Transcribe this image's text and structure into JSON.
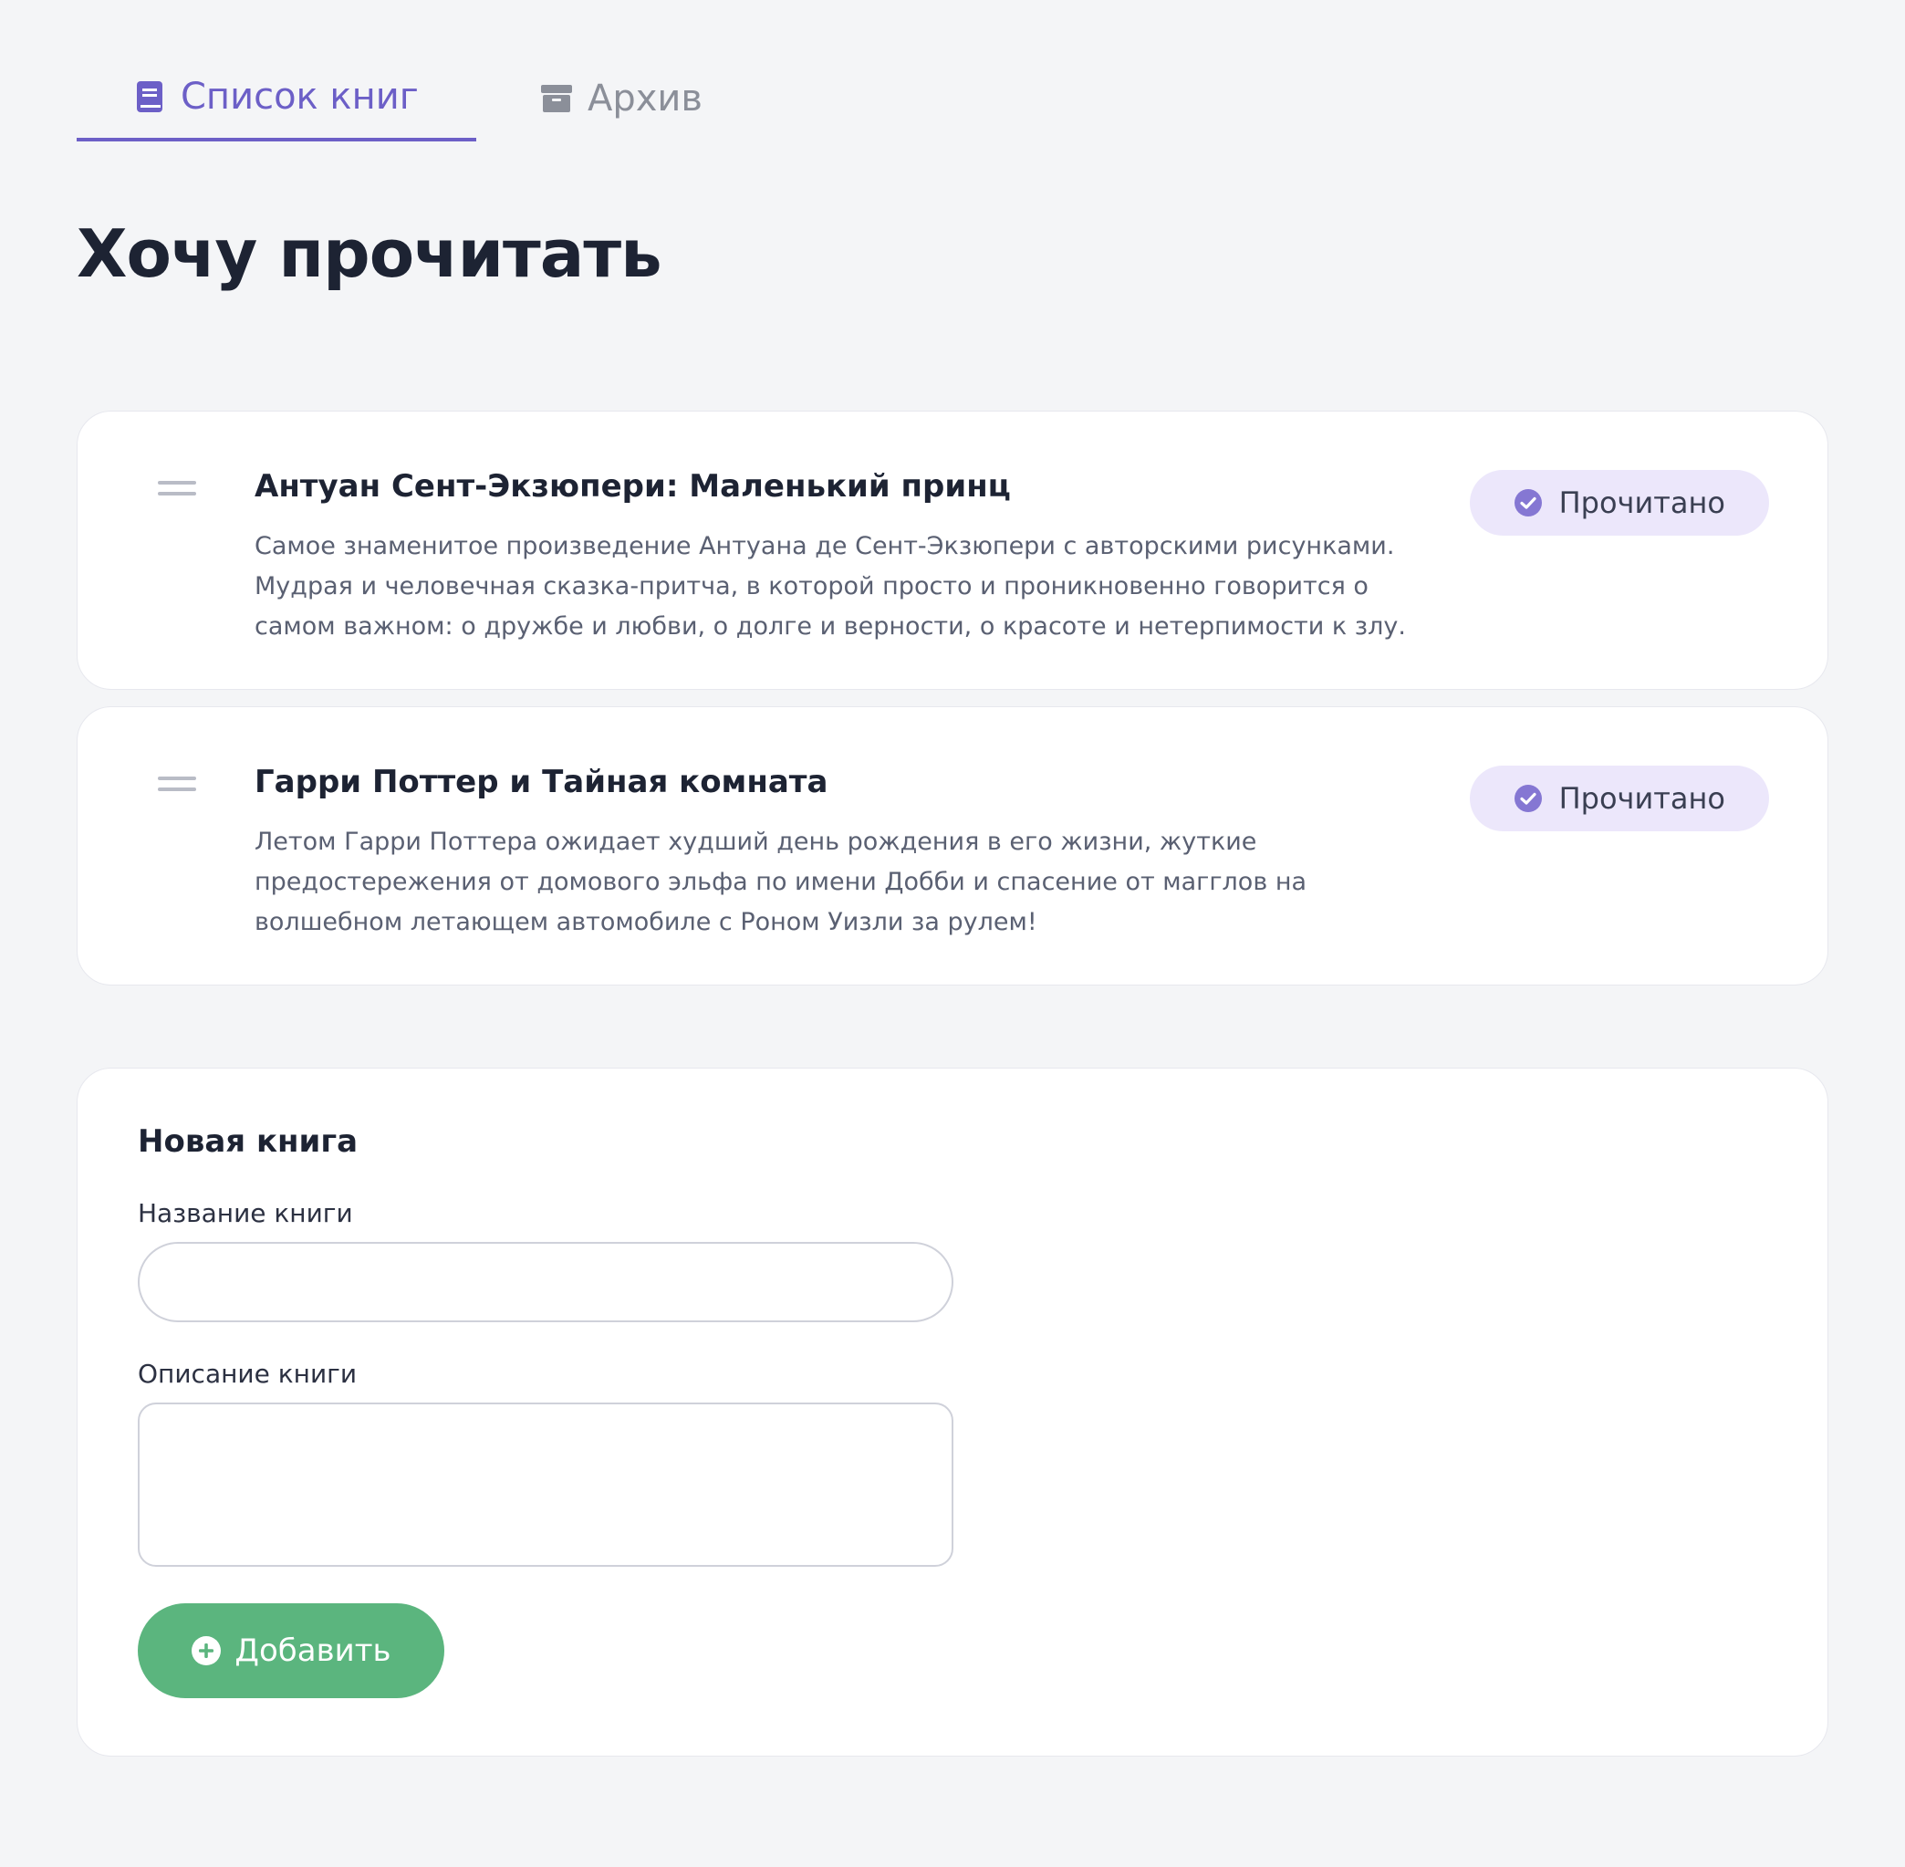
{
  "tabs": {
    "books_label": "Список книг",
    "archive_label": "Архив",
    "books_icon": "book-icon",
    "archive_icon": "archive-box-icon",
    "active_color": "#6c5fc7",
    "inactive_color": "#8b8f99"
  },
  "page": {
    "title": "Хочу прочитать"
  },
  "books": [
    {
      "title": "Антуан Сент-Экзюпери: Маленький принц",
      "description": "Самое знаменитое произведение Антуана де Сент-Экзюпери с авторскими рисунками.\nМудрая и человечная сказка-притча, в которой просто и проникновенно говорится о\nсамом важном: о дружбе и любви, о долге и верности, о красоте и нетерпимости к злу.",
      "status_label": "Прочитано"
    },
    {
      "title": "Гарри Поттер и Тайная комната",
      "description": "Летом Гарри Поттера ожидает худший день рождения в его жизни, жуткие\nпредостережения от домового эльфа по имени Добби и спасение от магглов на\nволшебном летающем автомобиле с Роном Уизли за рулем!",
      "status_label": "Прочитано"
    }
  ],
  "form": {
    "title": "Новая книга",
    "name_label": "Название книги",
    "name_value": "",
    "desc_label": "Описание книги",
    "desc_value": "",
    "add_label": "Добавить",
    "add_color": "#5bb57e"
  },
  "colors": {
    "accent": "#6c5fc7",
    "badge_bg": "#ece7fb",
    "success": "#5bb57e",
    "background": "#f4f5f7"
  }
}
